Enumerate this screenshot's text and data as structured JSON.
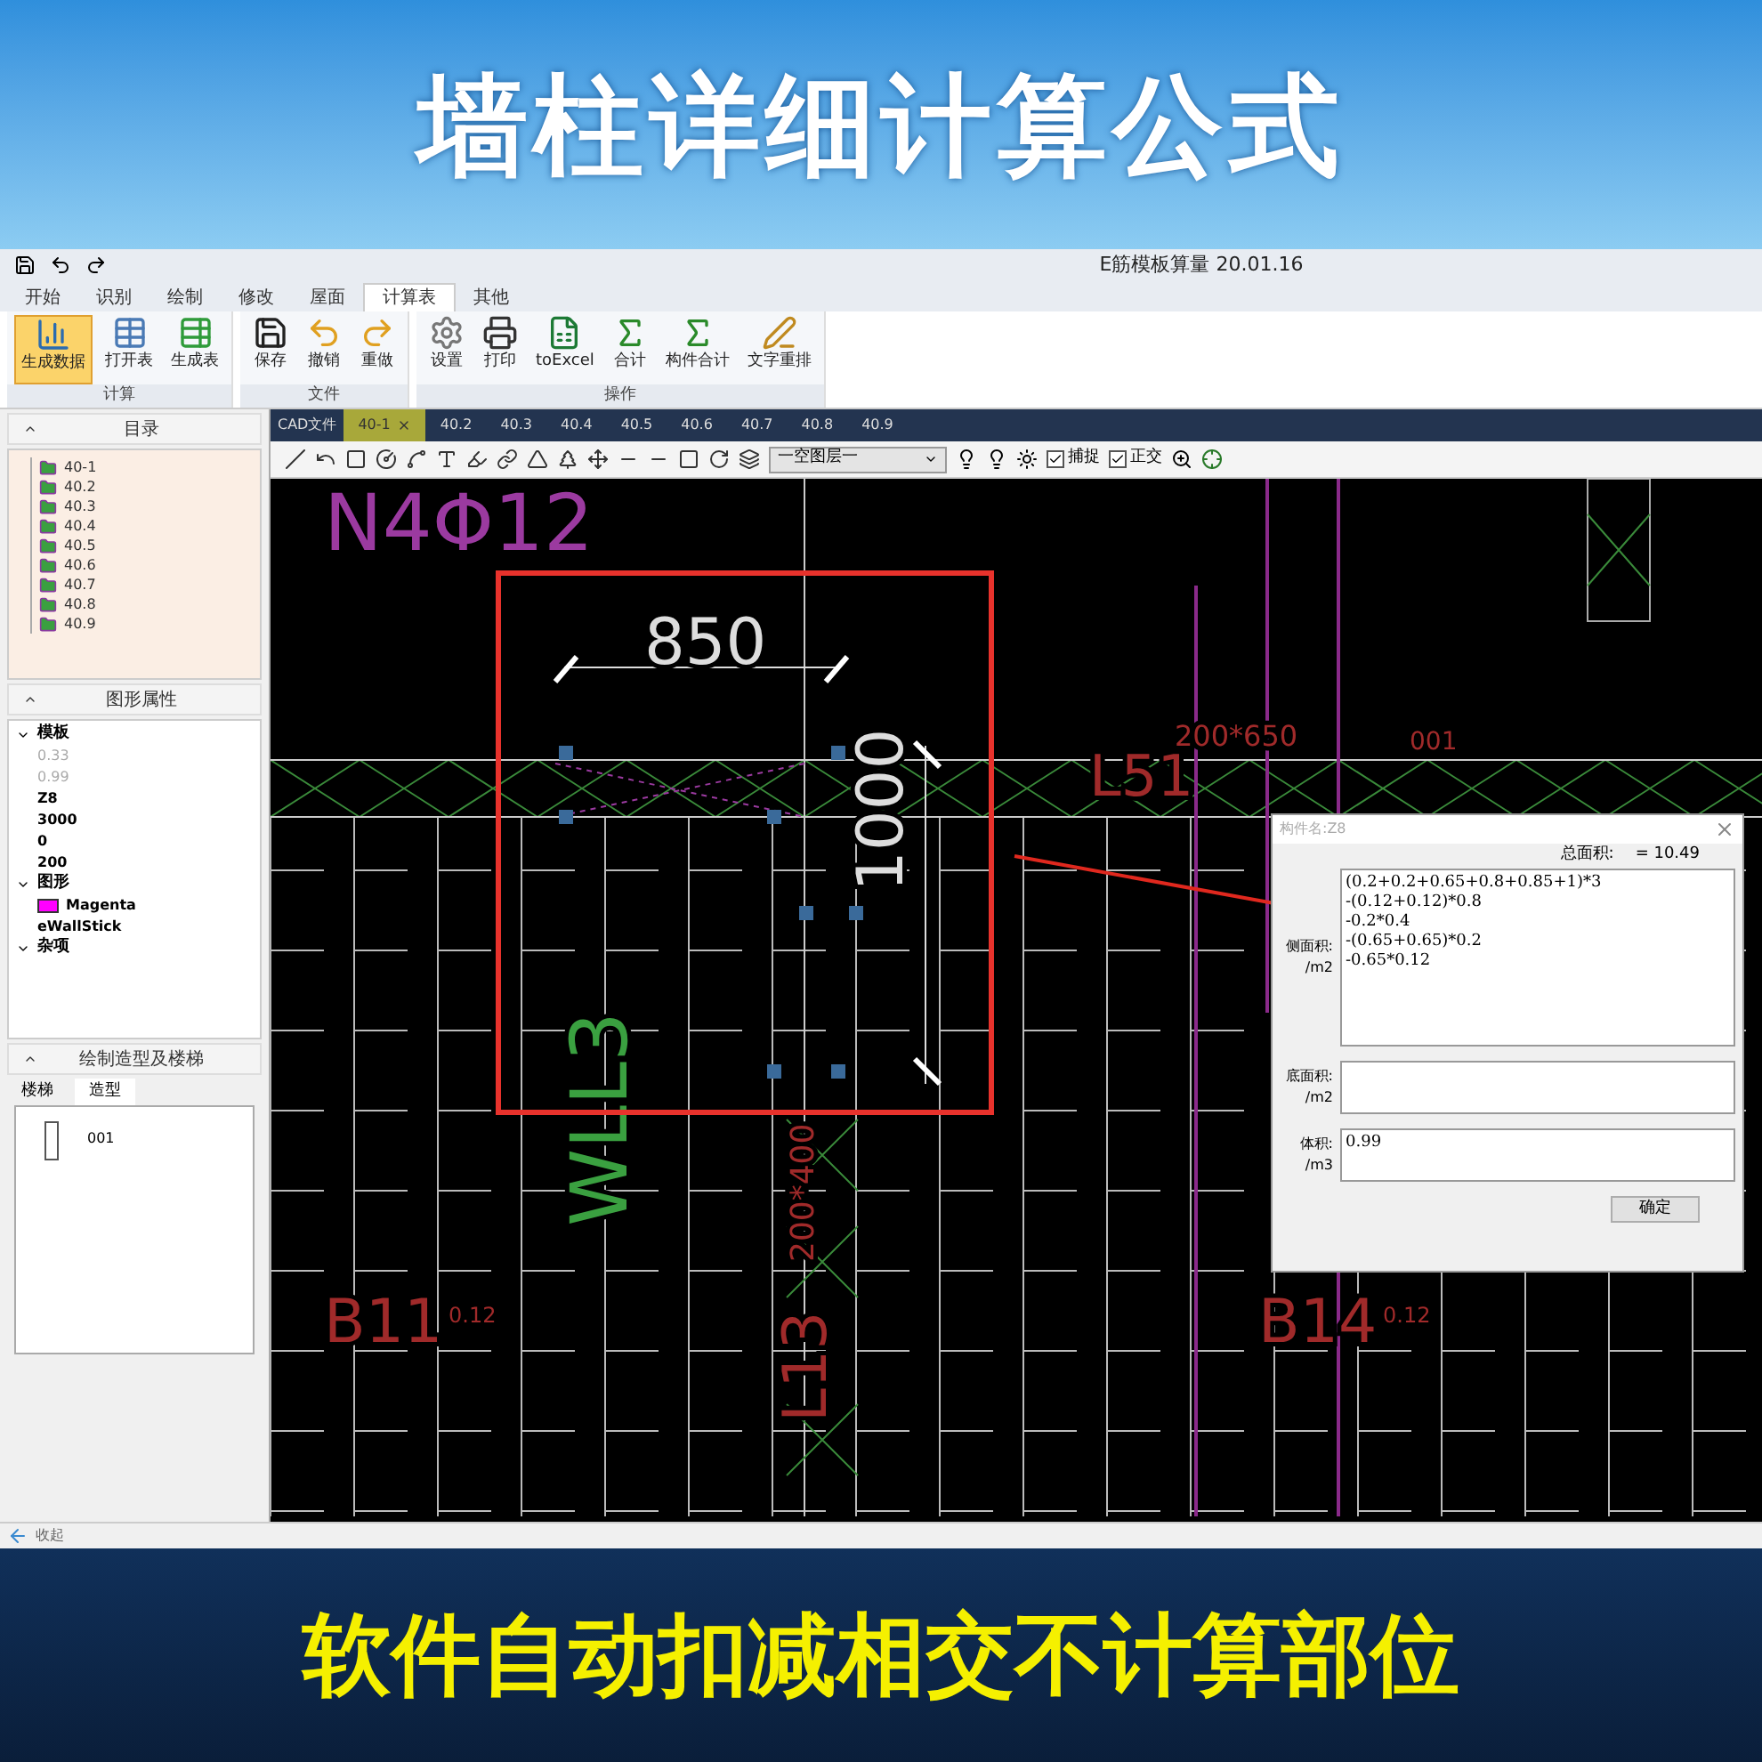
{
  "banner_title": "墙柱详细计算公式",
  "window": {
    "title": "E筋模板算量 20.01.16"
  },
  "menu_tabs": [
    {
      "label": "开始",
      "selected": false
    },
    {
      "label": "识别",
      "selected": false
    },
    {
      "label": "绘制",
      "selected": false
    },
    {
      "label": "修改",
      "selected": false
    },
    {
      "label": "屋面",
      "selected": false
    },
    {
      "label": "计算表",
      "selected": true
    },
    {
      "label": "其他",
      "selected": false
    }
  ],
  "ribbon_groups": [
    {
      "label": "计算",
      "buttons": [
        {
          "label": "生成数据",
          "selected": true
        },
        {
          "label": "打开表",
          "selected": false
        },
        {
          "label": "生成表",
          "selected": false
        }
      ]
    },
    {
      "label": "文件",
      "buttons": [
        {
          "label": "保存",
          "selected": false
        },
        {
          "label": "撤销",
          "selected": false
        },
        {
          "label": "重做",
          "selected": false
        }
      ]
    },
    {
      "label": "操作",
      "buttons": [
        {
          "label": "设置",
          "selected": false
        },
        {
          "label": "打印",
          "selected": false
        },
        {
          "label": "toExcel",
          "selected": false
        },
        {
          "label": "合计",
          "selected": false
        },
        {
          "label": "构件合计",
          "selected": false
        },
        {
          "label": "文字重排",
          "selected": false
        }
      ]
    }
  ],
  "catalog": {
    "title": "目录",
    "items": [
      {
        "label": "40-1"
      },
      {
        "label": "40.2"
      },
      {
        "label": "40.3"
      },
      {
        "label": "40.4"
      },
      {
        "label": "40.5"
      },
      {
        "label": "40.6"
      },
      {
        "label": "40.7"
      },
      {
        "label": "40.8"
      },
      {
        "label": "40.9"
      }
    ]
  },
  "properties": {
    "title": "图形属性",
    "groups": [
      {
        "label": "模板",
        "expanded": true,
        "rows": [
          {
            "value": "0.33",
            "disabled": true
          },
          {
            "value": "0.99",
            "disabled": true
          },
          {
            "value": "Z8",
            "disabled": false
          },
          {
            "value": "3000",
            "disabled": false
          },
          {
            "value": "0",
            "disabled": false
          },
          {
            "value": "200",
            "disabled": false
          }
        ]
      },
      {
        "label": "图形",
        "expanded": true,
        "rows": [
          {
            "value": "Magenta",
            "disabled": false,
            "color": "#ff00ff"
          },
          {
            "value": "eWallStick",
            "disabled": false
          }
        ]
      },
      {
        "label": "杂项",
        "expanded": true
      }
    ]
  },
  "shapes_panel": {
    "title": "绘制造型及楼梯",
    "tabs": [
      {
        "label": "楼梯",
        "selected": false
      },
      {
        "label": "造型",
        "selected": true
      }
    ],
    "items": [
      {
        "label": "001"
      }
    ]
  },
  "status_bar": {
    "label": "收起"
  },
  "doc_tabs": {
    "label": "CAD文件",
    "tabs": [
      {
        "label": "40-1",
        "selected": true
      },
      {
        "label": "40.2",
        "selected": false
      },
      {
        "label": "40.3",
        "selected": false
      },
      {
        "label": "40.4",
        "selected": false
      },
      {
        "label": "40.5",
        "selected": false
      },
      {
        "label": "40.6",
        "selected": false
      },
      {
        "label": "40.7",
        "selected": false
      },
      {
        "label": "40.8",
        "selected": false
      },
      {
        "label": "40.9",
        "selected": false
      }
    ]
  },
  "draw_toolbar": {
    "layer_select": "一空图层一",
    "checks": [
      {
        "label": "捕捉",
        "checked": true
      },
      {
        "label": "正交",
        "checked": true
      }
    ]
  },
  "cad_labels": [
    "N4Φ12",
    "850",
    "1000",
    "L51",
    "200*650",
    "001",
    "WLL3",
    "L13",
    "200*400",
    "B11",
    "0.12",
    "B14",
    "0.12"
  ],
  "dialog": {
    "title": "构件名:Z8",
    "total_label": "总面积:",
    "total_value": "= 10.49",
    "fields": [
      {
        "label": "侧面积:",
        "unit": "/m2",
        "lines": [
          "(0.2+0.2+0.65+0.8+0.85+1)*3",
          "-(0.12+0.12)*0.8",
          "-0.2*0.4",
          "-(0.65+0.65)*0.2",
          "-0.65*0.12"
        ]
      },
      {
        "label": "底面积:",
        "unit": "/m2"
      },
      {
        "label": "体积:",
        "unit": "/m3",
        "lines": [
          "0.99"
        ]
      }
    ],
    "ok": "确定"
  },
  "footer_text": "软件自动扣减相交不计算部位"
}
